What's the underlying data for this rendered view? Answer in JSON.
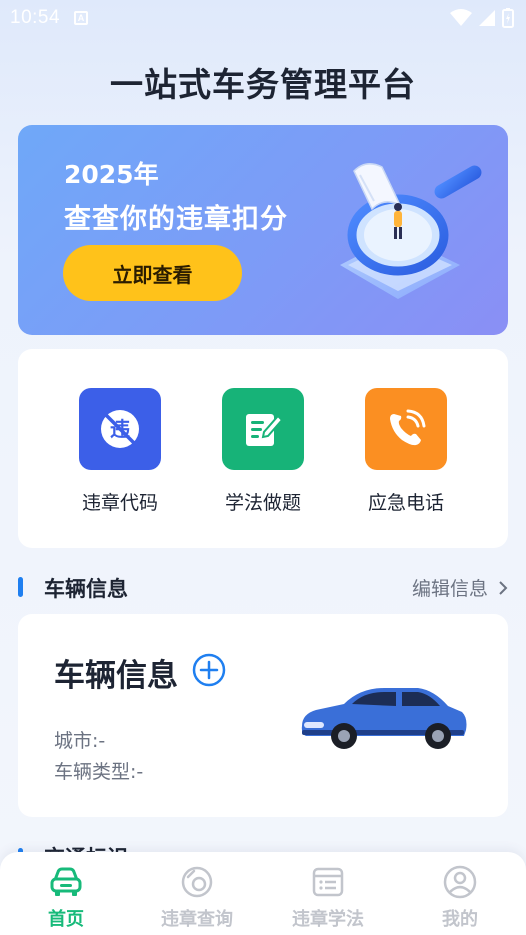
{
  "status_bar": {
    "time": "10:54",
    "notification_icon": "A"
  },
  "app": {
    "title": "一站式车务管理平台"
  },
  "banner": {
    "year": "2025年",
    "headline": "查查你的违章扣分",
    "button_label": "立即查看",
    "colors": {
      "button": "#ffc21a"
    }
  },
  "quick_actions": [
    {
      "label": "违章代码",
      "icon": "no-violation-icon",
      "color": "#3c5fe8"
    },
    {
      "label": "学法做题",
      "icon": "note-edit-icon",
      "color": "#17b378"
    },
    {
      "label": "应急电话",
      "icon": "phone-call-icon",
      "color": "#fb8f22"
    }
  ],
  "vehicle_section": {
    "title": "车辆信息",
    "edit_label": "编辑信息",
    "card_title": "车辆信息",
    "city": "城市:-",
    "vehicle_type": "车辆类型:-"
  },
  "traffic_section": {
    "title": "交通标识"
  },
  "tabbar": {
    "items": [
      {
        "label": "首页",
        "icon": "car-icon",
        "active": true
      },
      {
        "label": "违章查询",
        "icon": "camera-icon",
        "active": false
      },
      {
        "label": "违章学法",
        "icon": "list-icon",
        "active": false
      },
      {
        "label": "我的",
        "icon": "user-icon",
        "active": false
      }
    ],
    "colors": {
      "active": "#17ba7a",
      "inactive": "#c2c5cc"
    }
  }
}
